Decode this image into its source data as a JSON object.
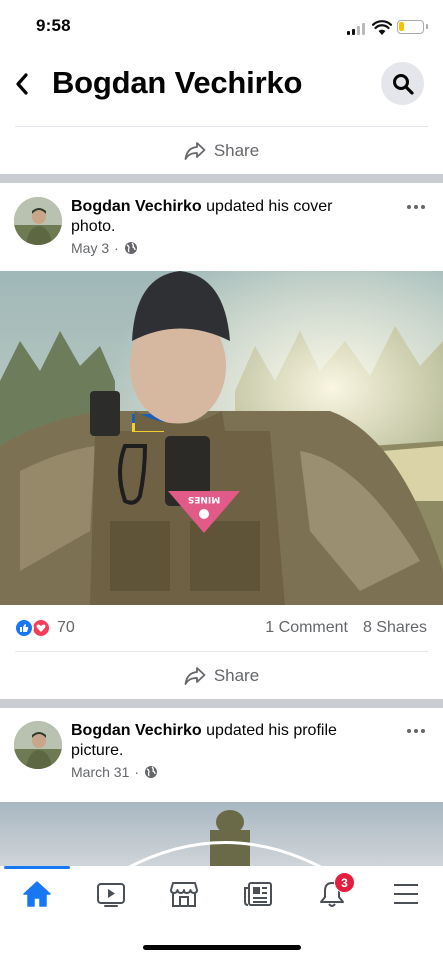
{
  "status_bar": {
    "time": "9:58"
  },
  "header": {
    "title": "Bogdan Vechirko",
    "back_icon": "back-chevron-icon",
    "search_icon": "search-icon"
  },
  "top_share": {
    "label": "Share"
  },
  "post1": {
    "author": "Bogdan Vechirko",
    "action": " updated his cover photo.",
    "date": "May 3",
    "separator": "·",
    "reaction_count": "70",
    "comments": "1 Comment",
    "shares": "8 Shares",
    "share_label": "Share",
    "patch_text": "MINES"
  },
  "post2": {
    "author": "Bogdan Vechirko",
    "action": " updated his profile picture.",
    "date": "March 31",
    "separator": "·"
  },
  "bottom_nav": {
    "items": [
      "home-icon",
      "video-icon",
      "marketplace-icon",
      "news-icon",
      "notifications-icon",
      "menu-icon"
    ],
    "notification_badge": "3",
    "active": "home"
  },
  "colors": {
    "accent": "#1877f2",
    "badge": "#e41e3f",
    "love": "#f33e58",
    "secondary_text": "#65676b"
  }
}
